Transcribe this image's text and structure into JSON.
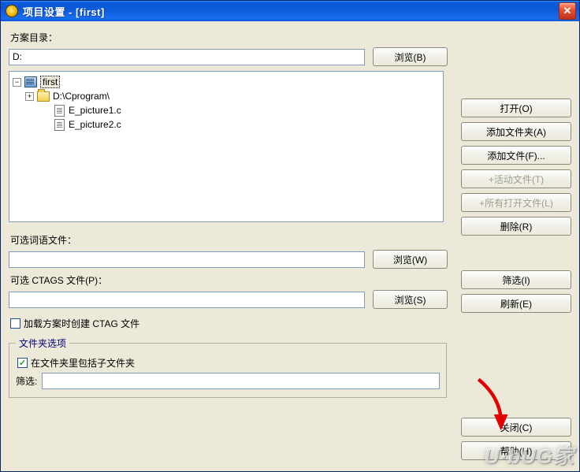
{
  "window": {
    "title": "项目设置 - [first]"
  },
  "directory": {
    "label": "方案目录：",
    "value": "D:",
    "browse": "浏览(B)"
  },
  "tree": {
    "root": "first",
    "folder": "D:\\Cprogram\\",
    "files": [
      "E_picture1.c",
      "E_picture2.c"
    ]
  },
  "sideButtons": {
    "open": "打开(O)",
    "addFolder": "添加文件夹(A)",
    "addFile": "添加文件(F)...",
    "addActive": "+活动文件(T)",
    "addAllOpen": "+所有打开文件(L)",
    "remove": "删除(R)",
    "filter": "筛选(I)",
    "refresh": "刷新(E)"
  },
  "wordFile": {
    "label": "可选词语文件：",
    "value": "",
    "browse": "浏览(W)"
  },
  "ctagsFile": {
    "label": "可选 CTAGS 文件(P)：",
    "value": "",
    "browse": "浏览(S)"
  },
  "ctagCheckbox": {
    "checked": false,
    "label": "加载方案时创建 CTAG 文件"
  },
  "folderOptions": {
    "legend": "文件夹选项",
    "subfolder": {
      "checked": true,
      "label": "在文件夹里包括子文件夹"
    },
    "filterLabel": "筛选:",
    "filterValue": ""
  },
  "footer": {
    "close": "关闭(C)",
    "help": "帮助(H)"
  },
  "watermark": "U·bUG家"
}
